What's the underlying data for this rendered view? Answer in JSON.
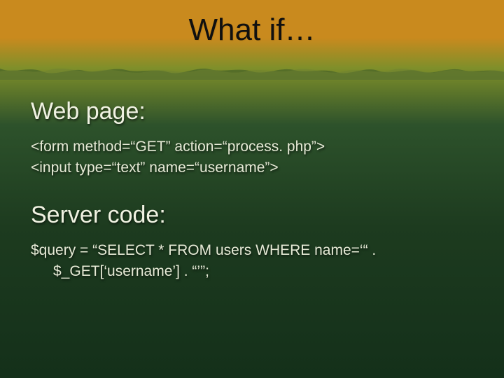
{
  "title": "What if…",
  "sections": [
    {
      "heading": "Web page:",
      "lines": [
        "<form method=“GET” action=“process. php”>",
        "<input type=“text” name=“username”>"
      ]
    },
    {
      "heading": "Server code:",
      "lines": [
        "$query = “SELECT * FROM users WHERE name=‘“ .",
        "$_GET[‘username’] . “’”;"
      ]
    }
  ]
}
